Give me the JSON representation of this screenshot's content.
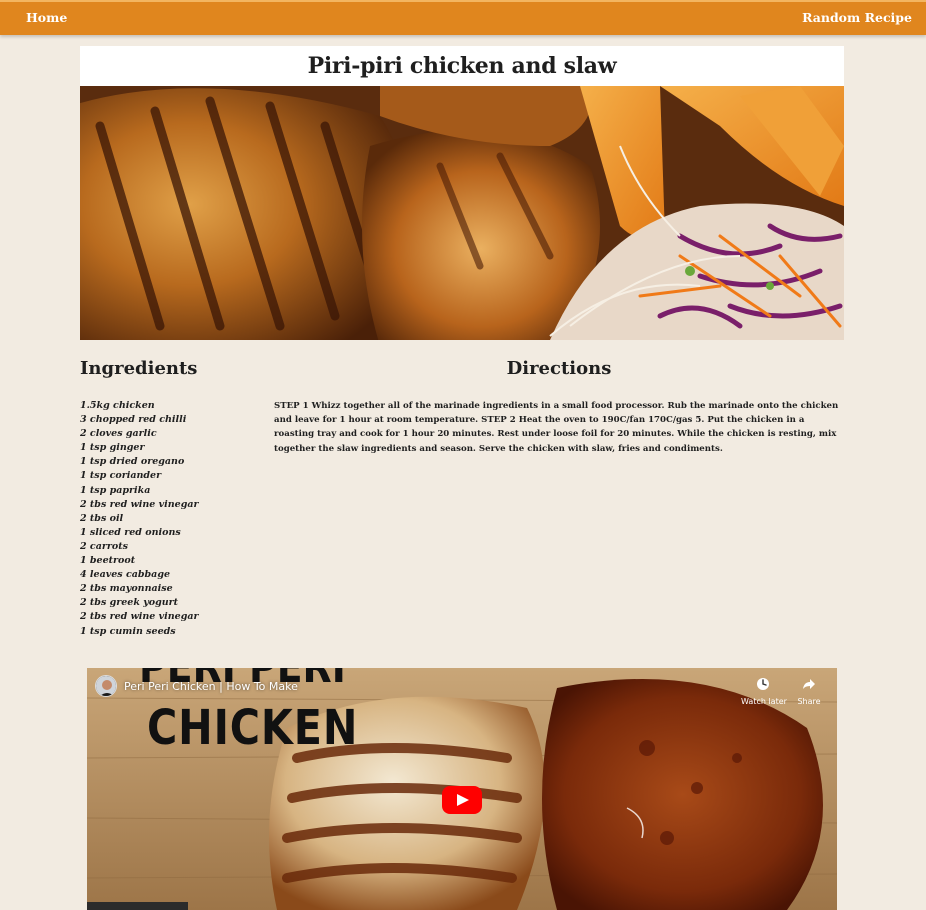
{
  "nav": {
    "home": "Home",
    "random": "Random Recipe"
  },
  "recipe": {
    "title": "Piri-piri chicken and slaw",
    "ingredients_heading": "Ingredients",
    "directions_heading": "Directions",
    "ingredients": [
      "1.5kg chicken",
      "3 chopped red chilli",
      "2 cloves garlic",
      "1 tsp ginger",
      "1 tsp dried oregano",
      "1 tsp coriander",
      "1 tsp paprika",
      "2 tbs red wine vinegar",
      "2 tbs oil",
      "1 sliced red onions",
      "2 carrots",
      "1 beetroot",
      "4 leaves cabbage",
      "2 tbs mayonnaise",
      "2 tbs greek yogurt",
      "2 tbs red wine vinegar",
      "1 tsp cumin seeds"
    ],
    "directions": "STEP 1 Whizz together all of the marinade ingredients in a small food processor. Rub the marinade onto the chicken and leave for 1 hour at room temperature. STEP 2 Heat the oven to 190C/fan 170C/gas 5. Put the chicken in a roasting tray and cook for 1 hour 20 minutes. Rest under loose foil for 20 minutes. While the chicken is resting, mix together the slaw ingredients and season. Serve the chicken with slaw, fries and condiments."
  },
  "video": {
    "title": "Peri Peri Chicken | How To Make",
    "overlay_top": "PERI PERI",
    "overlay_main": "CHICKEN",
    "watch_later": "Watch later",
    "share": "Share"
  },
  "colors": {
    "navbar": "#e0861e",
    "background": "#f2ebe1",
    "play_button": "#ff0000"
  }
}
